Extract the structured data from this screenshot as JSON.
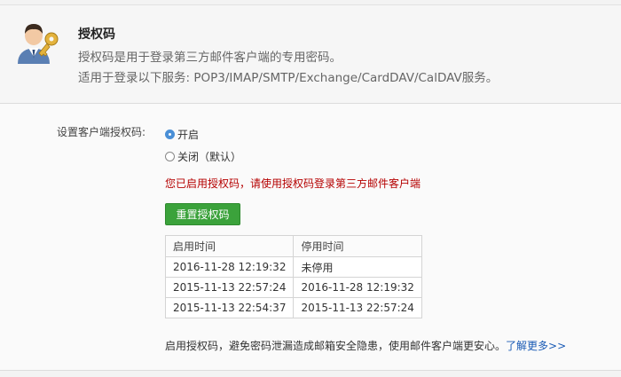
{
  "header": {
    "title": "授权码",
    "desc_line1": "授权码是用于登录第三方邮件客户端的专用密码。",
    "desc_line2": "适用于登录以下服务: POP3/IMAP/SMTP/Exchange/CardDAV/CalDAV服务。"
  },
  "setting": {
    "label": "设置客户端授权码:",
    "options": [
      {
        "label": "开启",
        "selected": true
      },
      {
        "label": "关闭（默认）",
        "selected": false
      }
    ]
  },
  "status_message": "您已启用授权码，请使用授权码登录第三方邮件客户端",
  "reset_button": "重置授权码",
  "log_table": {
    "headers": [
      "启用时间",
      "停用时间"
    ],
    "rows": [
      [
        "2016-11-28 12:19:32",
        "未停用"
      ],
      [
        "2015-11-13 22:57:24",
        "2016-11-28 12:19:32"
      ],
      [
        "2015-11-13 22:54:37",
        "2015-11-13 22:57:24"
      ]
    ]
  },
  "footer": {
    "note": "启用授权码，避免密码泄漏造成邮箱安全隐患，使用邮件客户端更安心。",
    "link": "了解更多>>"
  },
  "colors": {
    "accent_green": "#3ba23b",
    "warning_red": "#b50000",
    "link_blue": "#1a5bb5",
    "radio_blue": "#4a8fd6"
  },
  "icons": {
    "avatar": "user-with-key-icon"
  }
}
